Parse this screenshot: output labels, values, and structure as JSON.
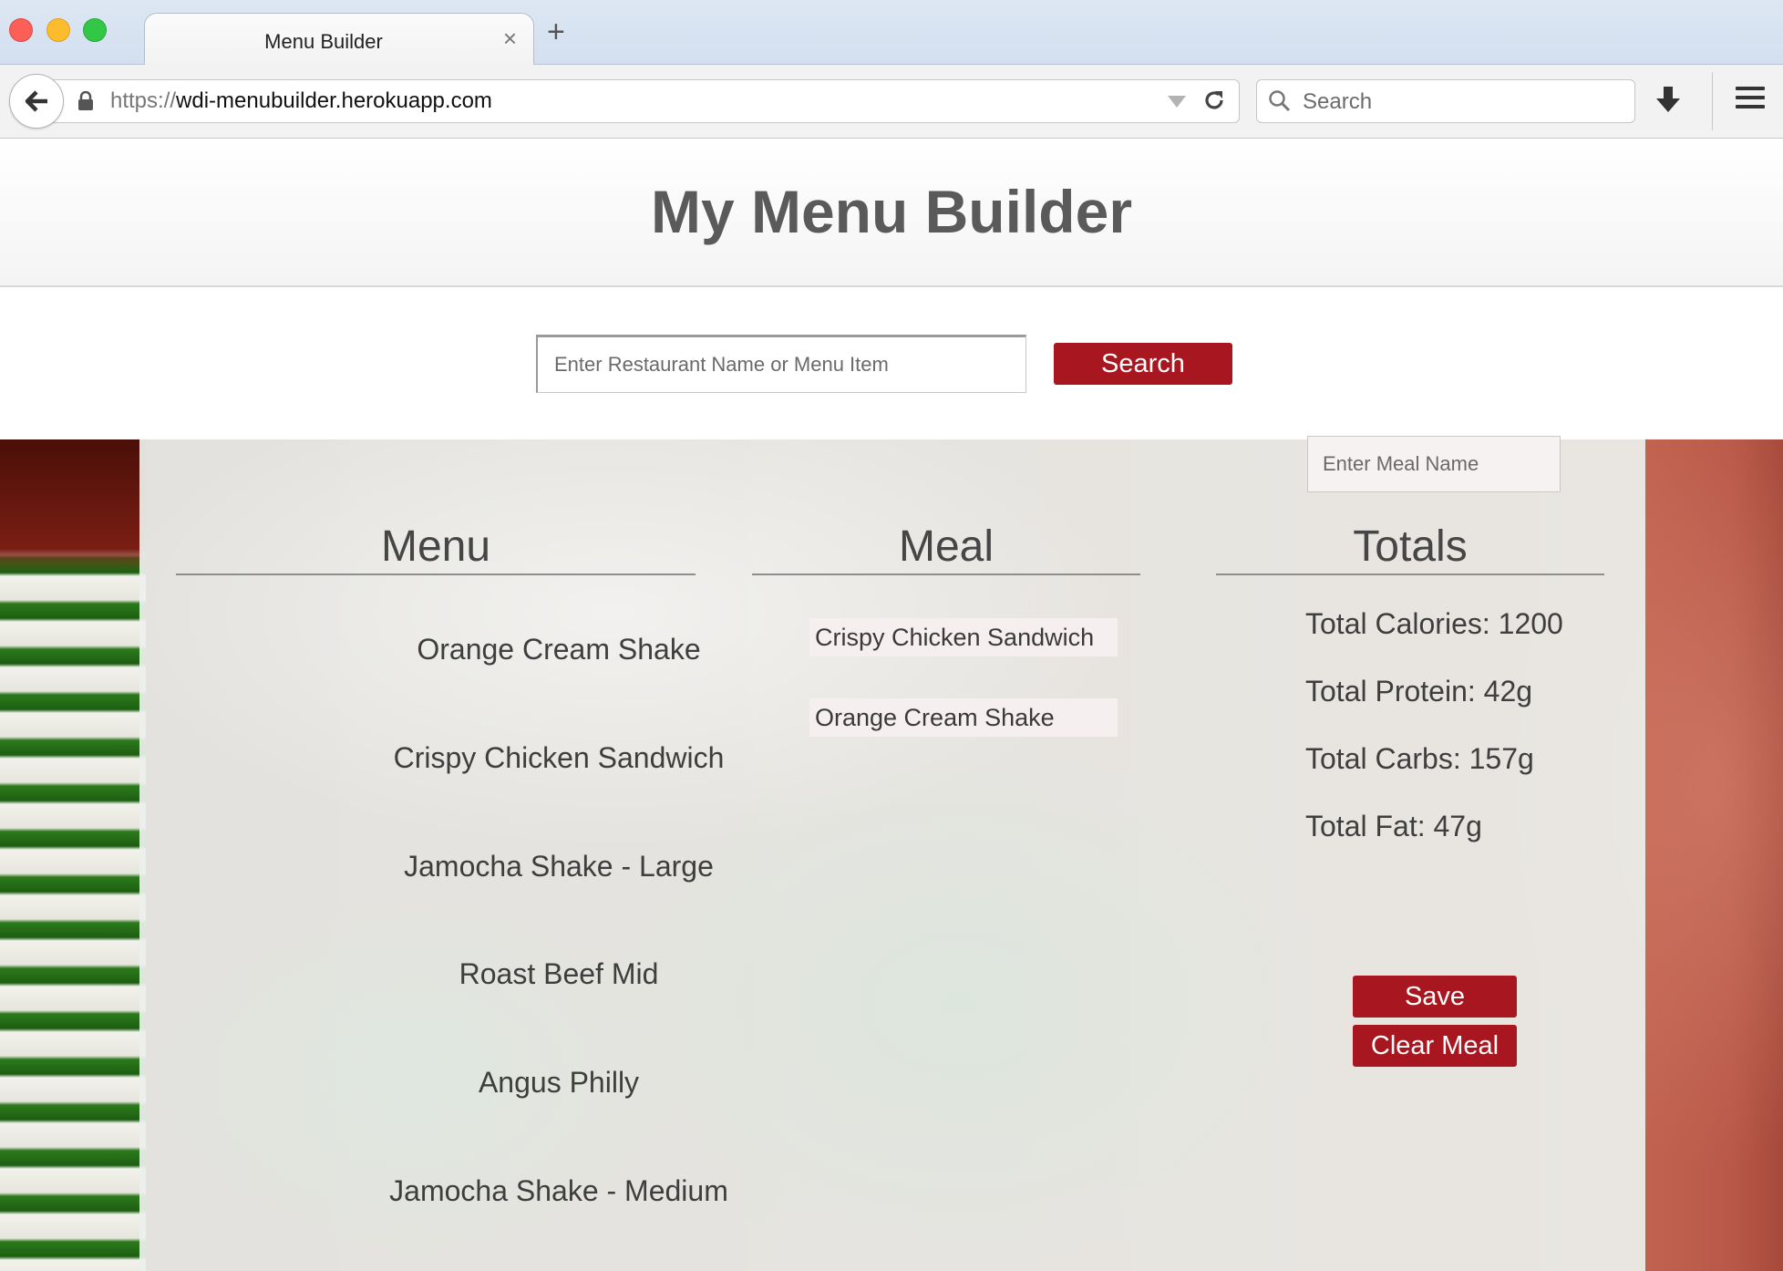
{
  "browser": {
    "tab_title": "Menu Builder",
    "tab_close": "×",
    "new_tab": "+",
    "url_protocol": "https://",
    "url_host": "wdi-menubuilder.herokuapp.com",
    "search_placeholder": "Search"
  },
  "page": {
    "title": "My Menu Builder",
    "search_placeholder": "Enter Restaurant Name or Menu Item",
    "search_button": "Search"
  },
  "menu": {
    "heading": "Menu",
    "items": [
      "Orange Cream Shake",
      "Crispy Chicken Sandwich",
      "Jamocha Shake - Large",
      "Roast Beef Mid",
      "Angus Philly",
      "Jamocha Shake - Medium"
    ]
  },
  "meal": {
    "heading": "Meal",
    "items": [
      "Crispy Chicken Sandwich",
      "Orange Cream Shake"
    ]
  },
  "totals": {
    "heading": "Totals",
    "calories": "Total Calories: 1200",
    "protein": "Total Protein: 42g",
    "carbs": "Total Carbs: 157g",
    "fat": "Total Fat: 47g",
    "meal_name_placeholder": "Enter Meal Name",
    "save_button": "Save",
    "clear_button": "Clear Meal"
  },
  "colors": {
    "accent": "#a8161f"
  }
}
